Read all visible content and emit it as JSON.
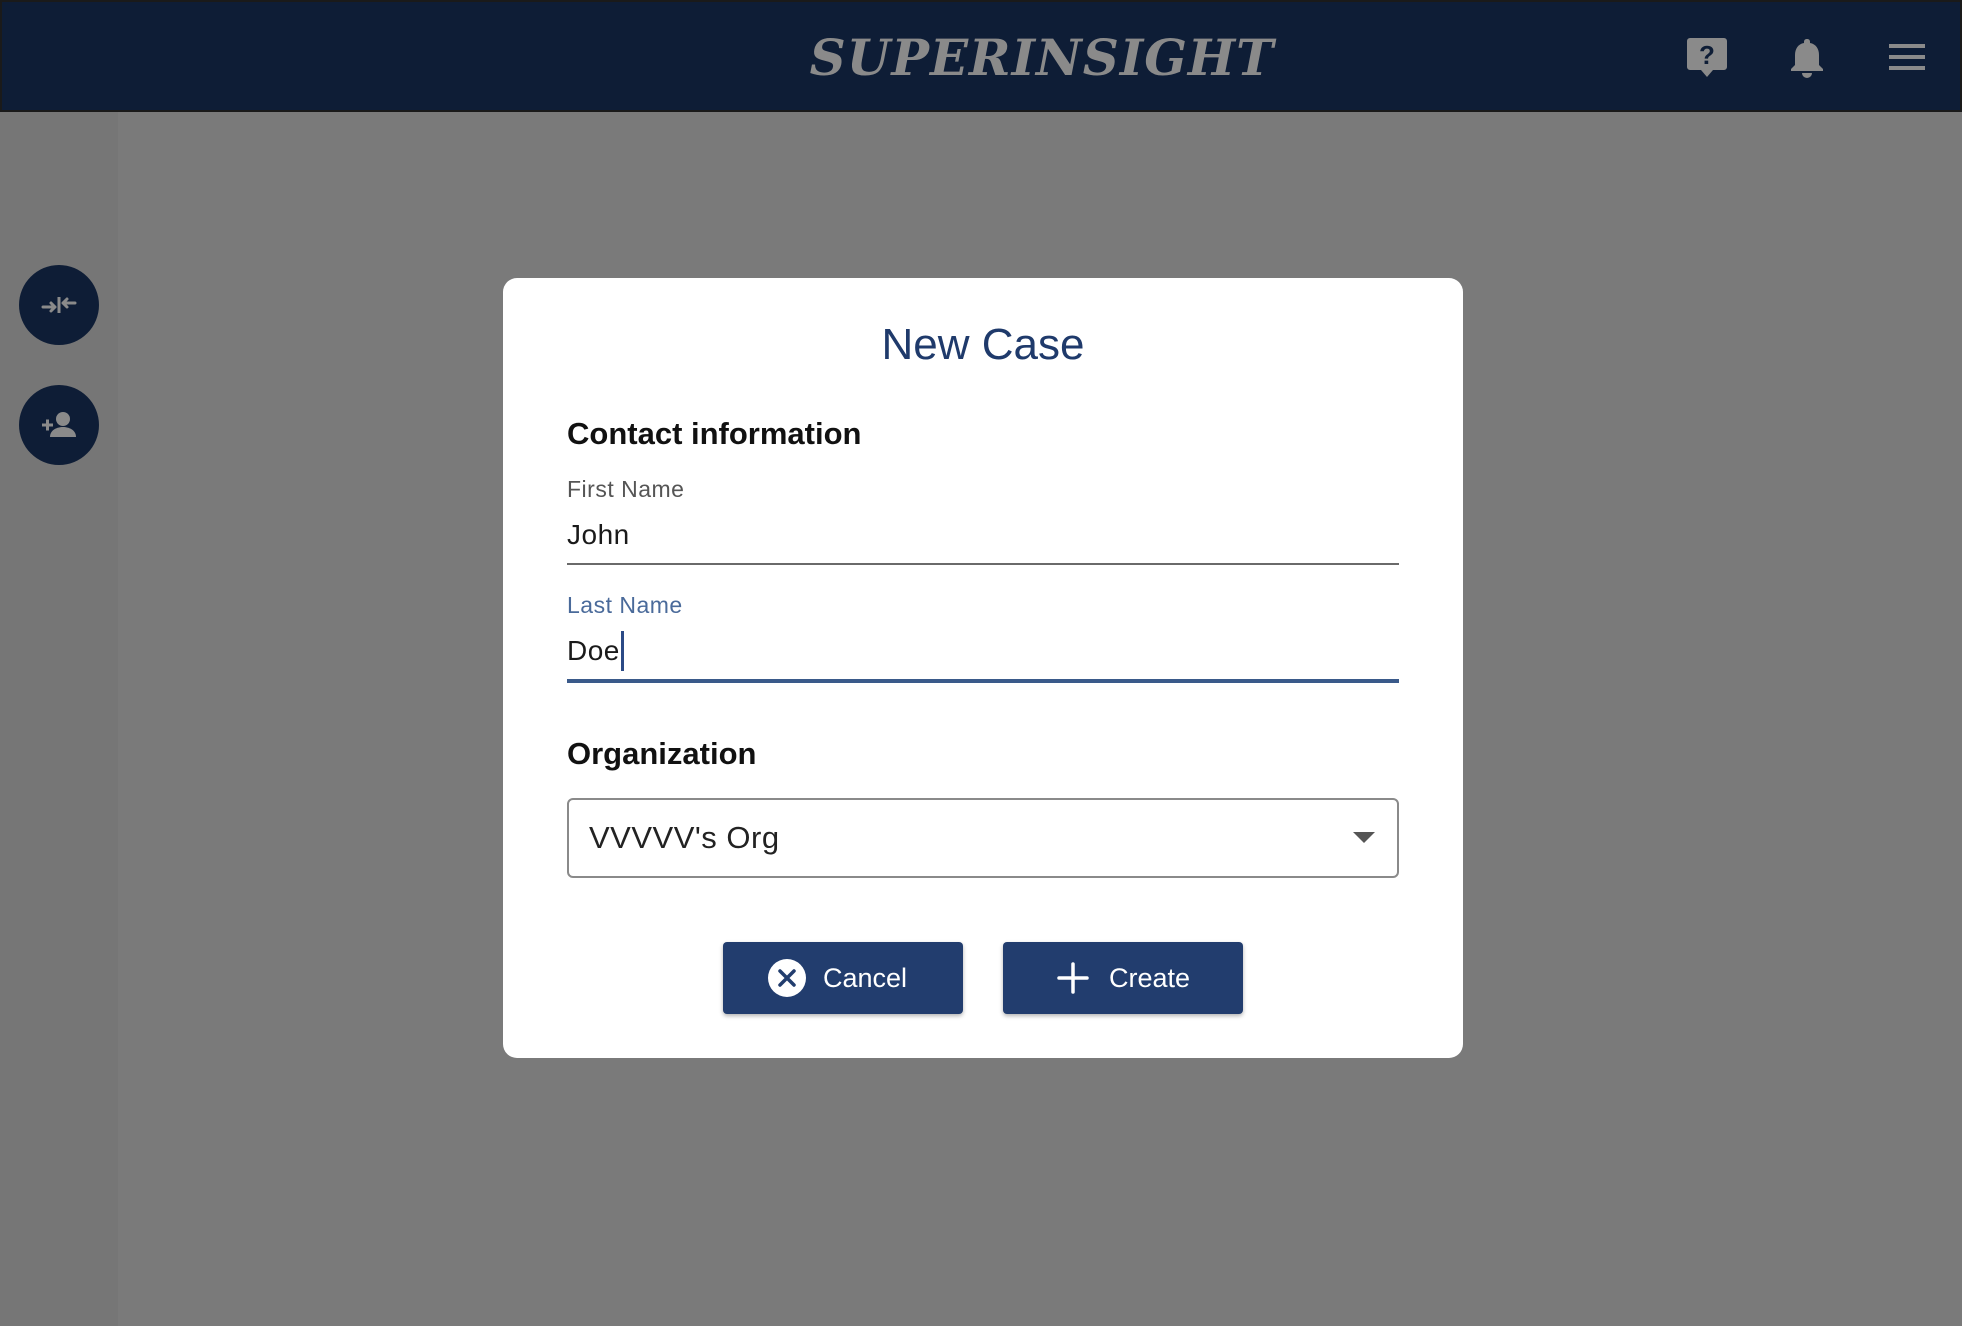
{
  "header": {
    "logo": "SUPERINSIGHT",
    "icons": [
      "help-icon",
      "bell-icon",
      "menu-icon"
    ],
    "background": "#0e1d36"
  },
  "rail": {
    "buttons": [
      "compress-icon",
      "add-user-icon"
    ]
  },
  "modal": {
    "title": "New Case",
    "contact_section": "Contact information",
    "first_name": {
      "label": "First Name",
      "value": "John"
    },
    "last_name": {
      "label": "Last Name",
      "value": "Doe"
    },
    "organization_section": "Organization",
    "organization_select": {
      "value": "VVVVV's Org"
    },
    "cancel_button": {
      "label": "Cancel",
      "icon": "close-circle-icon"
    },
    "create_button": {
      "label": "Create",
      "icon": "plus-icon"
    }
  },
  "colors": {
    "accent": "#223d6e",
    "title": "#1f3a6b",
    "overlay": "#7a7a7a"
  }
}
